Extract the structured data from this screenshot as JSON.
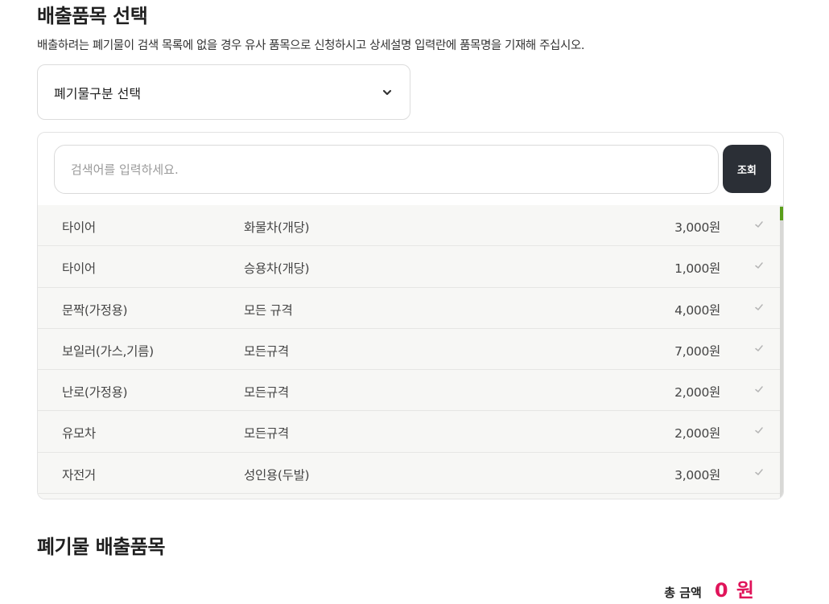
{
  "header": {
    "title": "배출품목 선택",
    "description": "배출하려는 폐기물이 검색 목록에 없을 경우 유사 품목으로 신청하시고 상세설명 입력란에 품목명을 기재해 주십시오."
  },
  "category_select": {
    "label": "폐기물구분 선택",
    "icon": "chevron-down-icon"
  },
  "search": {
    "placeholder": "검색어를 입력하세요.",
    "button_label": "조회"
  },
  "items": [
    {
      "category": "타이어",
      "spec": "화물차(개당)",
      "price": "3,000원"
    },
    {
      "category": "타이어",
      "spec": "승용차(개당)",
      "price": "1,000원"
    },
    {
      "category": "문짝(가정용)",
      "spec": "모든 규격",
      "price": "4,000원"
    },
    {
      "category": "보일러(가스,기름)",
      "spec": "모든규격",
      "price": "7,000원"
    },
    {
      "category": "난로(가정용)",
      "spec": "모든규격",
      "price": "2,000원"
    },
    {
      "category": "유모차",
      "spec": "모든규격",
      "price": "2,000원"
    },
    {
      "category": "자전거",
      "spec": "성인용(두발)",
      "price": "3,000원"
    }
  ],
  "colors": {
    "accent_total": "#e0145a",
    "scroll_thumb": "#5a9e1a",
    "button_bg": "#2b2f36"
  },
  "summary": {
    "title": "폐기물 배출품목",
    "total_label": "총 금액",
    "total_value": "0 원"
  }
}
